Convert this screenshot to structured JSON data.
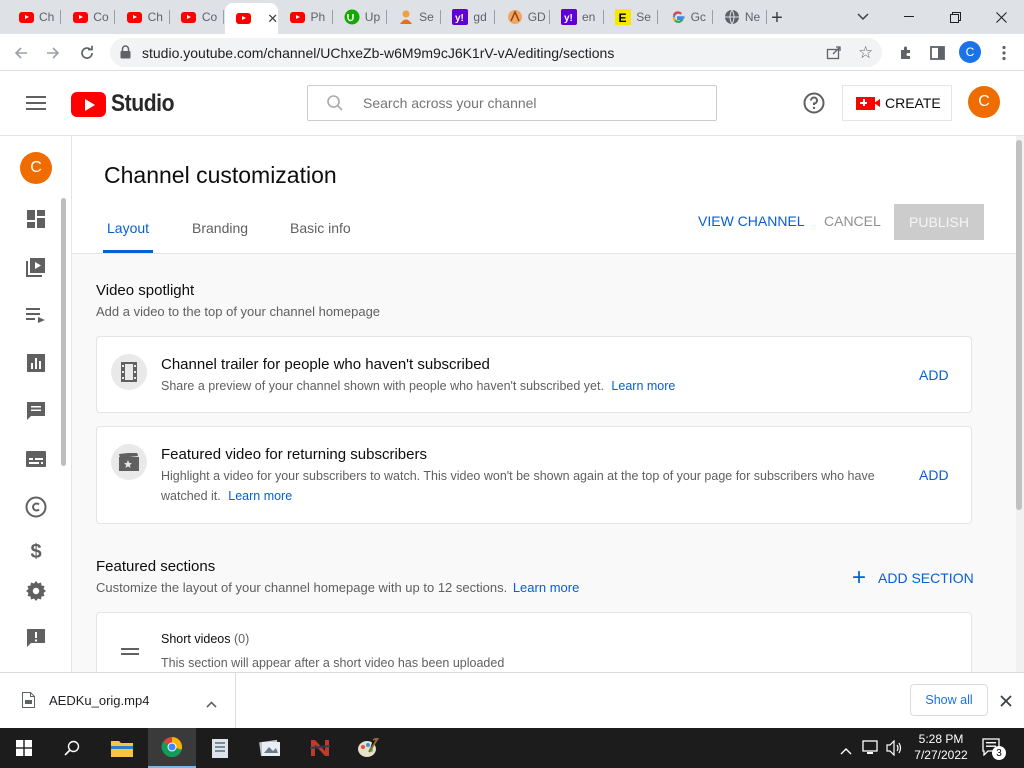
{
  "browser": {
    "tabs": [
      {
        "icon": "youtube-icon",
        "title": "Ch"
      },
      {
        "icon": "youtube-icon",
        "title": "Co"
      },
      {
        "icon": "youtube-icon",
        "title": "Ch"
      },
      {
        "icon": "youtube-icon",
        "title": "Co"
      },
      {
        "icon": "youtube-icon",
        "title": "",
        "active": true
      },
      {
        "icon": "youtube-icon",
        "title": "Ph"
      },
      {
        "icon": "upwork-icon",
        "title": "Up"
      },
      {
        "icon": "person-icon",
        "title": "Se"
      },
      {
        "icon": "yahoo-icon",
        "title": "gd"
      },
      {
        "icon": "gdrive-icon",
        "title": "GD"
      },
      {
        "icon": "yahoo-icon",
        "title": "en"
      },
      {
        "icon": "e-icon",
        "title": "Se"
      },
      {
        "icon": "google-icon",
        "title": "Gc"
      },
      {
        "icon": "globe-icon",
        "title": "Ne"
      }
    ],
    "url": "studio.youtube.com/channel/UChxeZb-w6M9m9cJ6K1rV-vA/editing/sections",
    "profile_initial": "C"
  },
  "header": {
    "logo_text": "Studio",
    "search_placeholder": "Search across your channel",
    "create_label": "CREATE",
    "avatar_initial": "C"
  },
  "sidebar": {
    "avatar_initial": "C"
  },
  "page": {
    "title": "Channel customization",
    "tabs": [
      "Layout",
      "Branding",
      "Basic info"
    ],
    "view_channel": "VIEW CHANNEL",
    "cancel": "CANCEL",
    "publish": "PUBLISH"
  },
  "spotlight": {
    "title": "Video spotlight",
    "subtitle": "Add a video to the top of your channel homepage",
    "trailer": {
      "title": "Channel trailer for people who haven't subscribed",
      "desc": "Share a preview of your channel shown with people who haven't subscribed yet.",
      "learn": "Learn more",
      "action": "ADD"
    },
    "featured": {
      "title": "Featured video for returning subscribers",
      "desc1": "Highlight a video for your subscribers to watch. This video won't be shown again at the top of your page for subscribers who have",
      "desc2": "watched it.",
      "learn": "Learn more",
      "action": "ADD"
    }
  },
  "sections": {
    "title": "Featured sections",
    "subtitle": "Customize the layout of your channel homepage with up to 12 sections.",
    "learn": "Learn more",
    "add_section": "ADD SECTION",
    "short_title": "Short videos",
    "short_count": "(0)",
    "short_desc": "This section will appear after a short video has been uploaded"
  },
  "download": {
    "filename": "AEDKu_orig.mp4",
    "show_all": "Show all"
  },
  "taskbar": {
    "time": "5:28 PM",
    "date": "7/27/2022",
    "notifications": "3"
  },
  "colors": {
    "accent": "#065fd4",
    "youtube_red": "#ff0000",
    "avatar": "#ef6c00",
    "publish_bg": "#cccccc"
  }
}
